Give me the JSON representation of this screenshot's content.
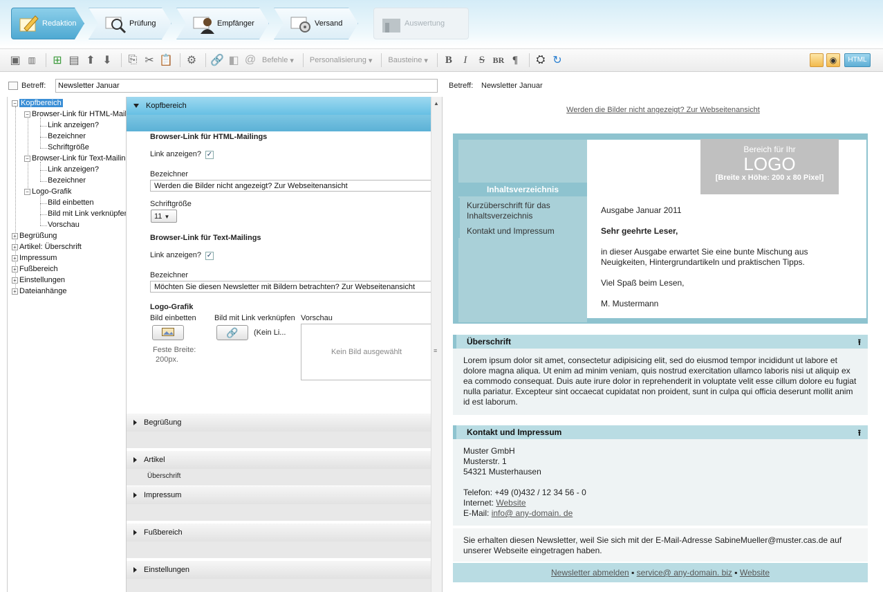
{
  "wizard": {
    "steps": [
      {
        "label": "Redaktion"
      },
      {
        "label": "Prüfung"
      },
      {
        "label": "Empfänger"
      },
      {
        "label": "Versand"
      },
      {
        "label": "Auswertung"
      }
    ]
  },
  "toolbar": {
    "befehle": "Befehle",
    "personalisierung": "Personalisierung",
    "bausteine": "Bausteine",
    "bold": "B",
    "italic": "I",
    "strike": "S",
    "br": "BR",
    "para": "¶",
    "html": "HTML"
  },
  "subject": {
    "label": "Betreff:",
    "value": "Newsletter Januar",
    "preview_label": "Betreff:",
    "preview_value": "Newsletter Januar"
  },
  "tree": {
    "kopfbereich": "Kopfbereich",
    "browser_html": "Browser-Link für HTML-Mailings",
    "link_anzeigen_1": "Link anzeigen?",
    "bezeichner_1": "Bezeichner",
    "schriftgroesse": "Schriftgröße",
    "browser_text": "Browser-Link für Text-Mailings",
    "link_anzeigen_2": "Link anzeigen?",
    "bezeichner_2": "Bezeichner",
    "logo_grafik": "Logo-Grafik",
    "bild_einbetten": "Bild einbetten",
    "bild_link": "Bild mit Link verknüpfen",
    "vorschau": "Vorschau",
    "begruessung": "Begrüßung",
    "artikel": "Artikel: Überschrift",
    "impressum": "Impressum",
    "fussbereich": "Fußbereich",
    "einstellungen": "Einstellungen",
    "dateianhaenge": "Dateianhänge"
  },
  "editor": {
    "kopfbereich": "Kopfbereich",
    "browser_html_title": "Browser-Link für HTML-Mailings",
    "link_anzeigen_1": "Link anzeigen?",
    "link_anzeigen_1_checked": true,
    "bezeichner_1_label": "Bezeichner",
    "bezeichner_1_value": "Werden die Bilder nicht angezeigt? Zur Webseitenansicht",
    "schriftgroesse_label": "Schriftgröße",
    "schriftgroesse_value": "11",
    "browser_text_title": "Browser-Link für Text-Mailings",
    "link_anzeigen_2": "Link anzeigen?",
    "link_anzeigen_2_checked": true,
    "bezeichner_2_label": "Bezeichner",
    "bezeichner_2_value": "Möchten Sie diesen Newsletter mit Bildern betrachten? Zur Webseitenansicht",
    "logo_title": "Logo-Grafik",
    "bild_einbetten": "Bild einbetten",
    "bild_link": "Bild mit Link verknüpfen",
    "kein_link": "(Kein Li...",
    "vorschau": "Vorschau",
    "feste_breite_1": "Feste Breite:",
    "feste_breite_2": "200px.",
    "kein_bild": "Kein Bild ausgewählt",
    "sections": {
      "begruessung": "Begrüßung",
      "artikel": "Artikel",
      "artikel_sub": "Überschrift",
      "impressum": "Impressum",
      "fussbereich": "Fußbereich",
      "einstellungen": "Einstellungen"
    }
  },
  "preview": {
    "browser_link": "Werden die Bilder nicht angezeigt? Zur Webseitenansicht",
    "logo_line1": "Bereich für Ihr",
    "logo_line2": "LOGO",
    "logo_line3": "[Breite x Höhe: 200 x 80 Pixel]",
    "toc_title": "Inhaltsverzeichnis",
    "toc_item1": "Kurzüberschrift für das Inhaltsverzeichnis",
    "toc_item2": "Kontakt und Impressum",
    "ausgabe": "Ausgabe Januar 2011",
    "anrede": "Sehr geehrte Leser,",
    "intro": "in dieser Ausgabe erwartet Sie eine bunte Mischung aus Neuigkeiten, Hintergrundartikeln und praktischen Tipps.",
    "spass": "Viel Spaß beim Lesen,",
    "signatur": "M. Mustermann",
    "ueberschrift": "Überschrift",
    "lorem": "Lorem ipsum dolor sit amet, consectetur adipisicing elit, sed do eiusmod tempor incididunt ut labore et dolore magna aliqua. Ut enim ad minim veniam, quis nostrud exercitation ullamco laboris nisi ut aliquip ex ea commodo consequat. Duis aute irure dolor in reprehenderit in voluptate velit esse cillum dolore eu fugiat nulla pariatur. Excepteur sint occaecat cupidatat non proident, sunt in culpa qui officia deserunt mollit anim id est laborum.",
    "kontakt_title": "Kontakt und Impressum",
    "firma": "Muster GmbH",
    "strasse": "Musterstr. 1",
    "ort": "54321 Musterhausen",
    "telefon": "Telefon: +49 (0)432 / 12 34 56 - 0",
    "internet_label": "Internet:",
    "internet_link": "Website",
    "email_label": "E-Mail:",
    "email_link": "info@ any-domain. de",
    "footer_note": "Sie erhalten diesen Newsletter, weil Sie sich mit der E-Mail-Adresse SabineMueller@muster.cas.de auf unserer Webseite eingetragen haben.",
    "abmelden": "Newsletter abmelden",
    "service": "service@ any-domain. biz",
    "website": "Website",
    "bullet": "▪"
  },
  "colors": {
    "accent": "#67c0e4",
    "newsletter_blue": "#8ec3cf",
    "newsletter_light": "#b9dce3"
  }
}
